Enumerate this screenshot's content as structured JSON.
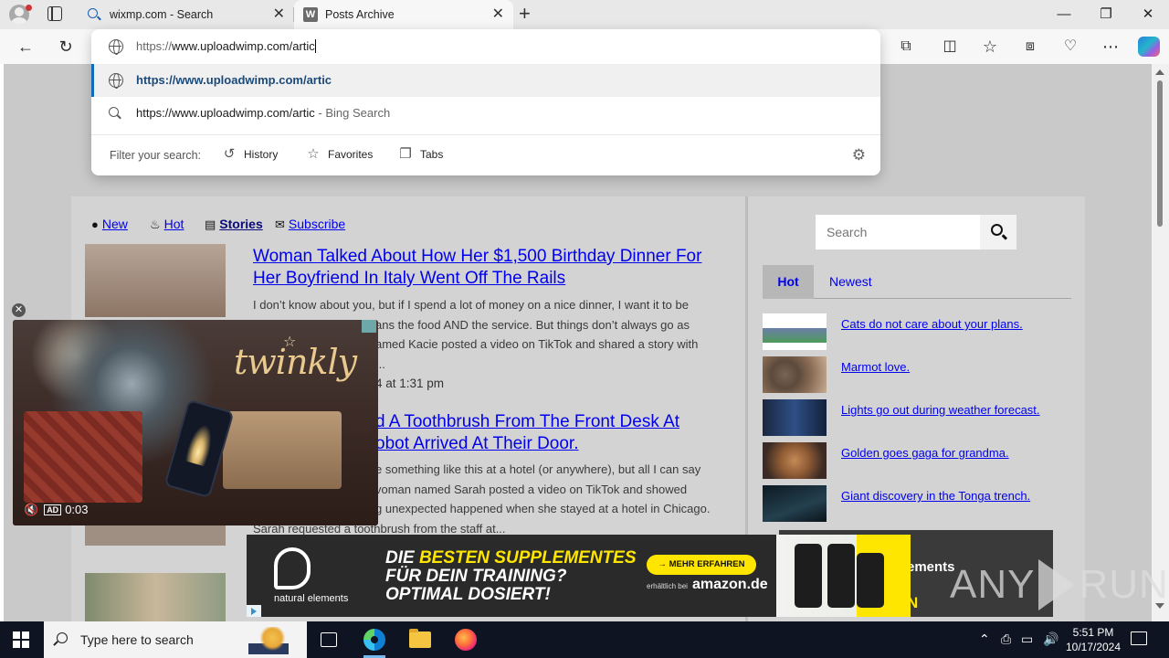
{
  "browser": {
    "tabs": [
      {
        "title": "wixmp.com - Search",
        "favicon": "bing-search-icon"
      },
      {
        "title": "Posts Archive",
        "favicon": "w-logo-icon"
      }
    ],
    "window_controls": {
      "minimize": "—",
      "restore": "❐",
      "close": "✕"
    }
  },
  "omnibox": {
    "typed_prefix": "https://",
    "typed_rest": "www.uploadwimp.com/artic",
    "suggestions": [
      {
        "text": "https://www.uploadwimp.com/artic",
        "suffix": "",
        "icon": "globe-icon"
      },
      {
        "text": "https://www.uploadwimp.com/artic",
        "suffix": " - Bing Search",
        "icon": "search-icon"
      }
    ],
    "filter_label": "Filter your search:",
    "filters": [
      "History",
      "Favorites",
      "Tabs"
    ]
  },
  "site": {
    "nav": {
      "new": "New",
      "hot": "Hot",
      "stories": "Stories",
      "subscribe": "Subscribe"
    },
    "posts": [
      {
        "title": "Woman Talked About How Her $1,500 Birthday Dinner For Her Boyfriend In Italy Went Off The Rails",
        "excerpt": "I don’t know about you, but if I spend a lot of money on a nice dinner, I want it to be ... ans the food AND the service. But things don’t always go as ... amed Kacie posted a video on TikTok and shared a story with ...",
        "excerpt_lines": [
          "I don’t know about you, but if I spend a lot of money on a nice dinner, I want it to be",
          "ans the food AND the service. But things don’t always go as",
          "amed Kacie posted a video on TikTok and shared a story with",
          "..."
        ],
        "date": "4 at 1:31 pm"
      },
      {
        "title_lines": [
          "d A Toothbrush From The Front Desk At",
          "obot Arrived At Their Door."
        ],
        "excerpt_lines": [
          "e something like this at a hotel (or anywhere), but all I can say",
          "voman named Sarah posted a video on TikTok and showed",
          "g unexpected happened when she stayed at a hotel in Chicago.",
          "Sarah requested a toothbrush from the staff at..."
        ]
      }
    ],
    "sidebar": {
      "search_placeholder": "Search",
      "tabs": {
        "hot": "Hot",
        "newest": "Newest"
      },
      "items": [
        {
          "label": "Cats do not care about your plans."
        },
        {
          "label": "Marmot love."
        },
        {
          "label": "Lights go out during weather forecast."
        },
        {
          "label": "Golden goes gaga for grandma."
        },
        {
          "label": "Giant discovery in the Tonga trench."
        }
      ]
    }
  },
  "video_ad": {
    "brand": "twinkly",
    "badge": "AD",
    "time": "0:03",
    "mute_icon": "🔇"
  },
  "banner_ad": {
    "brand": "natural elements",
    "headline_1a": "DIE ",
    "headline_1b": "BESTEN SUPPLEMENTES",
    "headline_2": "FÜR DEIN TRAINING?",
    "headline_3": "OPTIMAL DOSIERT!",
    "cta": "→ MEHR ERFAHREN",
    "small": "erhältlich bei",
    "amazon": "amazon.de"
  },
  "side_ad": {
    "text": "ements",
    "yellow": "N"
  },
  "watermark": {
    "left": "ANY",
    "right": "RUN"
  },
  "taskbar": {
    "search_placeholder": "Type here to search",
    "time": "5:51 PM",
    "date": "10/17/2024"
  },
  "colors": {
    "link": "#0000ee",
    "accent": "#0f6cbd",
    "ad_yellow": "#ffe600"
  }
}
